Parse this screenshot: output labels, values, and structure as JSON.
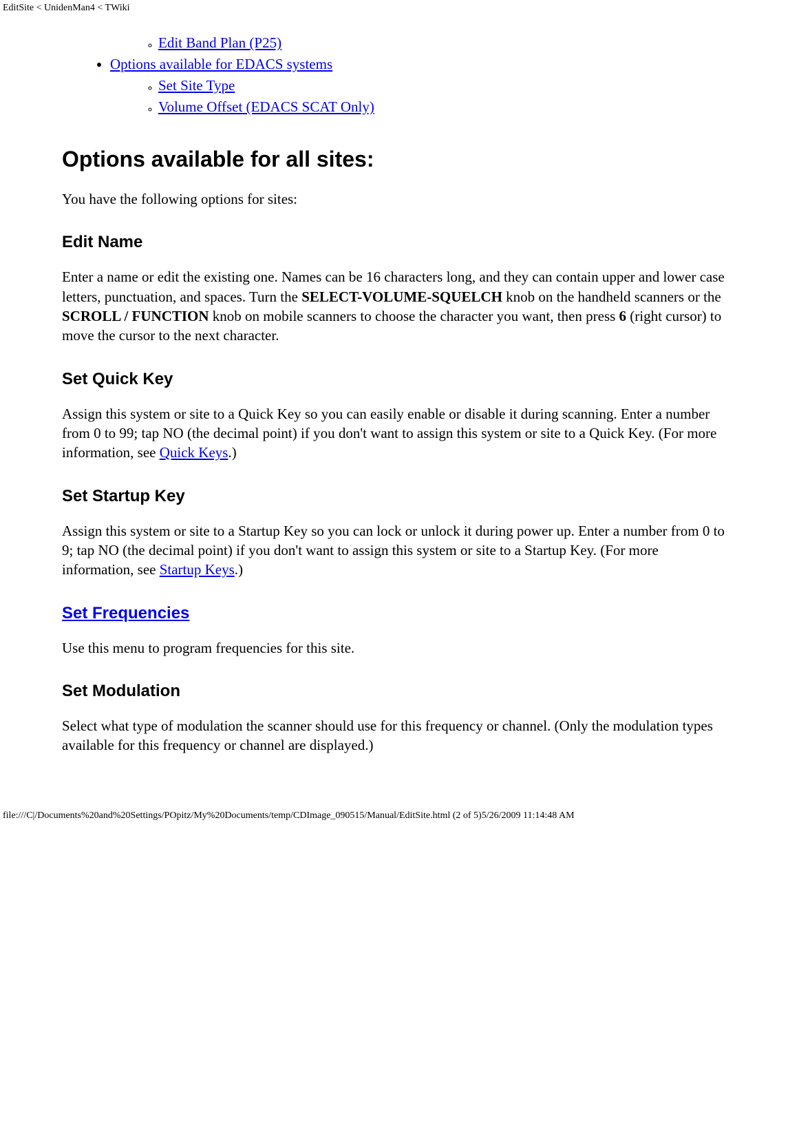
{
  "header": {
    "breadcrumb": "EditSite < UnidenMan4 < TWiki"
  },
  "toc": {
    "items": [
      {
        "sub": [
          {
            "label": "Edit Band Plan (P25)"
          }
        ]
      },
      {
        "label": "Options available for EDACS systems",
        "sub": [
          {
            "label": "Set Site Type"
          },
          {
            "label": "Volume Offset (EDACS SCAT Only)"
          }
        ]
      }
    ]
  },
  "sections": {
    "options_all": {
      "title": "Options available for all sites:",
      "intro": "You have the following options for sites:"
    },
    "edit_name": {
      "title": "Edit Name",
      "p_pre": "Enter a name or edit the existing one. Names can be 16 characters long, and they can contain upper and lower case letters, punctuation, and spaces. Turn the ",
      "b1": "SELECT-VOLUME-SQUELCH",
      "p_mid1": " knob on the handheld scanners or the ",
      "b2": "SCROLL / FUNCTION",
      "p_mid2": " knob on mobile scanners to choose the character you want, then press ",
      "b3": "6",
      "p_post": " (right cursor) to move the cursor to the next character."
    },
    "set_quick_key": {
      "title": "Set Quick Key",
      "p_pre": "Assign this system or site to a Quick Key so you can easily enable or disable it during scanning. Enter a number from 0 to 99; tap NO (the decimal point) if you don't want to assign this system or site to a Quick Key. (For more information, see ",
      "link": "Quick Keys",
      "p_post": ".)"
    },
    "set_startup_key": {
      "title": "Set Startup Key",
      "p_pre": "Assign this system or site to a Startup Key so you can lock or unlock it during power up. Enter a number from 0 to 9; tap NO (the decimal point) if you don't want to assign this system or site to a Startup Key. (For more information, see ",
      "link": "Startup Keys",
      "p_post": ".)"
    },
    "set_frequencies": {
      "title": "Set Frequencies",
      "p": "Use this menu to program frequencies for this site."
    },
    "set_modulation": {
      "title": "Set Modulation",
      "p": "Select what type of modulation the scanner should use for this frequency or channel. (Only the modulation types available for this frequency or channel are displayed.)"
    }
  },
  "footer": {
    "text": "file:///C|/Documents%20and%20Settings/POpitz/My%20Documents/temp/CDImage_090515/Manual/EditSite.html (2 of 5)5/26/2009 11:14:48 AM"
  }
}
